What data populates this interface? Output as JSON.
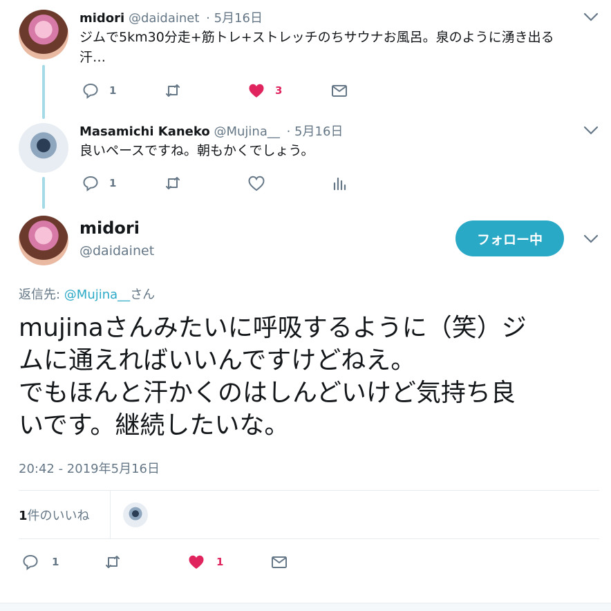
{
  "tweet1": {
    "name": "midori",
    "handle": "@daidainet",
    "date": "· 5月16日",
    "text_line1": "ジムで5km30分走+筋トレ+ストレッチのちサウナお風呂。泉のように湧き出る",
    "text_line2": "汗…",
    "reply_count": "1",
    "like_count": "3"
  },
  "tweet2": {
    "name": "Masamichi Kaneko",
    "handle": "@Mujina__",
    "date": "· 5月16日",
    "text": "良いペースですね。朝もかくでしょう。",
    "reply_count": "1"
  },
  "main": {
    "name": "midori",
    "handle": "@daidainet",
    "follow_label": "フォロー中",
    "reply_prefix": "返信先: ",
    "reply_handle": "@Mujina__",
    "reply_suffix": "さん",
    "text_line1": "mujinaさんみたいに呼吸するように（笑）ジ",
    "text_line2": "ムに通えればいいんですけどねえ。",
    "text_line3": "でもほんと汗かくのはしんどいけど気持ち良",
    "text_line4": "いです。継続したいな。",
    "timestamp": "20:42 - 2019年5月16日",
    "likes_count": "1",
    "likes_label": "件のいいね",
    "reply_count": "1",
    "like_count": "1"
  },
  "colors": {
    "accent": "#2aa9c6",
    "like": "#e0245e",
    "muted": "#657786",
    "thread": "#a4d9e6"
  },
  "icons": [
    "reply-icon",
    "retweet-icon",
    "heart-icon",
    "mail-icon",
    "analytics-icon",
    "chevron-down-icon"
  ]
}
